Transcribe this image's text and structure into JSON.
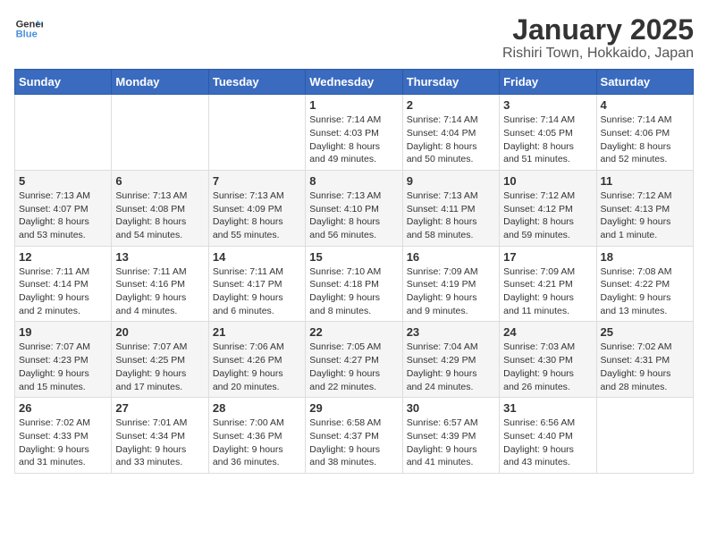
{
  "header": {
    "logo_line1": "General",
    "logo_line2": "Blue",
    "title": "January 2025",
    "subtitle": "Rishiri Town, Hokkaido, Japan"
  },
  "weekdays": [
    "Sunday",
    "Monday",
    "Tuesday",
    "Wednesday",
    "Thursday",
    "Friday",
    "Saturday"
  ],
  "weeks": [
    [
      {
        "day": "",
        "info": ""
      },
      {
        "day": "",
        "info": ""
      },
      {
        "day": "",
        "info": ""
      },
      {
        "day": "1",
        "info": "Sunrise: 7:14 AM\nSunset: 4:03 PM\nDaylight: 8 hours\nand 49 minutes."
      },
      {
        "day": "2",
        "info": "Sunrise: 7:14 AM\nSunset: 4:04 PM\nDaylight: 8 hours\nand 50 minutes."
      },
      {
        "day": "3",
        "info": "Sunrise: 7:14 AM\nSunset: 4:05 PM\nDaylight: 8 hours\nand 51 minutes."
      },
      {
        "day": "4",
        "info": "Sunrise: 7:14 AM\nSunset: 4:06 PM\nDaylight: 8 hours\nand 52 minutes."
      }
    ],
    [
      {
        "day": "5",
        "info": "Sunrise: 7:13 AM\nSunset: 4:07 PM\nDaylight: 8 hours\nand 53 minutes."
      },
      {
        "day": "6",
        "info": "Sunrise: 7:13 AM\nSunset: 4:08 PM\nDaylight: 8 hours\nand 54 minutes."
      },
      {
        "day": "7",
        "info": "Sunrise: 7:13 AM\nSunset: 4:09 PM\nDaylight: 8 hours\nand 55 minutes."
      },
      {
        "day": "8",
        "info": "Sunrise: 7:13 AM\nSunset: 4:10 PM\nDaylight: 8 hours\nand 56 minutes."
      },
      {
        "day": "9",
        "info": "Sunrise: 7:13 AM\nSunset: 4:11 PM\nDaylight: 8 hours\nand 58 minutes."
      },
      {
        "day": "10",
        "info": "Sunrise: 7:12 AM\nSunset: 4:12 PM\nDaylight: 8 hours\nand 59 minutes."
      },
      {
        "day": "11",
        "info": "Sunrise: 7:12 AM\nSunset: 4:13 PM\nDaylight: 9 hours\nand 1 minute."
      }
    ],
    [
      {
        "day": "12",
        "info": "Sunrise: 7:11 AM\nSunset: 4:14 PM\nDaylight: 9 hours\nand 2 minutes."
      },
      {
        "day": "13",
        "info": "Sunrise: 7:11 AM\nSunset: 4:16 PM\nDaylight: 9 hours\nand 4 minutes."
      },
      {
        "day": "14",
        "info": "Sunrise: 7:11 AM\nSunset: 4:17 PM\nDaylight: 9 hours\nand 6 minutes."
      },
      {
        "day": "15",
        "info": "Sunrise: 7:10 AM\nSunset: 4:18 PM\nDaylight: 9 hours\nand 8 minutes."
      },
      {
        "day": "16",
        "info": "Sunrise: 7:09 AM\nSunset: 4:19 PM\nDaylight: 9 hours\nand 9 minutes."
      },
      {
        "day": "17",
        "info": "Sunrise: 7:09 AM\nSunset: 4:21 PM\nDaylight: 9 hours\nand 11 minutes."
      },
      {
        "day": "18",
        "info": "Sunrise: 7:08 AM\nSunset: 4:22 PM\nDaylight: 9 hours\nand 13 minutes."
      }
    ],
    [
      {
        "day": "19",
        "info": "Sunrise: 7:07 AM\nSunset: 4:23 PM\nDaylight: 9 hours\nand 15 minutes."
      },
      {
        "day": "20",
        "info": "Sunrise: 7:07 AM\nSunset: 4:25 PM\nDaylight: 9 hours\nand 17 minutes."
      },
      {
        "day": "21",
        "info": "Sunrise: 7:06 AM\nSunset: 4:26 PM\nDaylight: 9 hours\nand 20 minutes."
      },
      {
        "day": "22",
        "info": "Sunrise: 7:05 AM\nSunset: 4:27 PM\nDaylight: 9 hours\nand 22 minutes."
      },
      {
        "day": "23",
        "info": "Sunrise: 7:04 AM\nSunset: 4:29 PM\nDaylight: 9 hours\nand 24 minutes."
      },
      {
        "day": "24",
        "info": "Sunrise: 7:03 AM\nSunset: 4:30 PM\nDaylight: 9 hours\nand 26 minutes."
      },
      {
        "day": "25",
        "info": "Sunrise: 7:02 AM\nSunset: 4:31 PM\nDaylight: 9 hours\nand 28 minutes."
      }
    ],
    [
      {
        "day": "26",
        "info": "Sunrise: 7:02 AM\nSunset: 4:33 PM\nDaylight: 9 hours\nand 31 minutes."
      },
      {
        "day": "27",
        "info": "Sunrise: 7:01 AM\nSunset: 4:34 PM\nDaylight: 9 hours\nand 33 minutes."
      },
      {
        "day": "28",
        "info": "Sunrise: 7:00 AM\nSunset: 4:36 PM\nDaylight: 9 hours\nand 36 minutes."
      },
      {
        "day": "29",
        "info": "Sunrise: 6:58 AM\nSunset: 4:37 PM\nDaylight: 9 hours\nand 38 minutes."
      },
      {
        "day": "30",
        "info": "Sunrise: 6:57 AM\nSunset: 4:39 PM\nDaylight: 9 hours\nand 41 minutes."
      },
      {
        "day": "31",
        "info": "Sunrise: 6:56 AM\nSunset: 4:40 PM\nDaylight: 9 hours\nand 43 minutes."
      },
      {
        "day": "",
        "info": ""
      }
    ]
  ]
}
